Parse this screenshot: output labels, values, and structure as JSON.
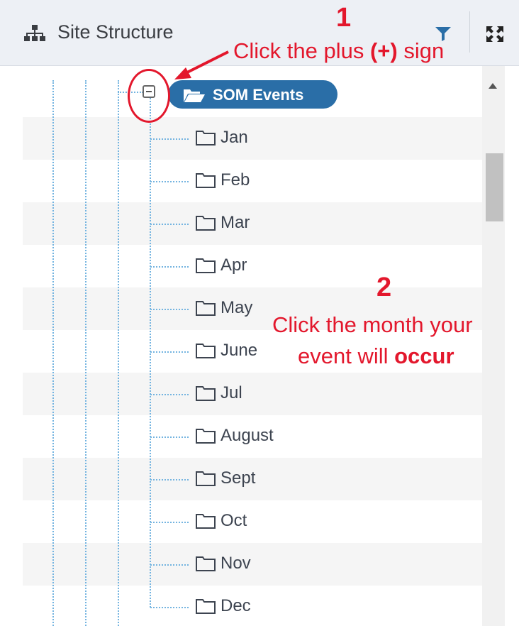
{
  "header": {
    "title": "Site Structure",
    "icons": {
      "sitemap": "sitemap-icon",
      "filter": "filter-icon",
      "expand": "expand-icon"
    }
  },
  "tree": {
    "root": {
      "label": "SOM Events",
      "icon": "folder-open-icon",
      "toggle": "minus-box-icon"
    },
    "months": [
      "Jan",
      "Feb",
      "Mar",
      "Apr",
      "May",
      "June",
      "Jul",
      "August",
      "Sept",
      "Oct",
      "Nov",
      "Dec"
    ]
  },
  "annotations": {
    "step1": {
      "number": "1",
      "text_before": "Click the plus ",
      "text_bold": "(+)",
      "text_after": " sign"
    },
    "step2": {
      "number": "2",
      "line1": "Click the month your",
      "line2_before": "event will ",
      "line2_bold": "occur"
    }
  },
  "colors": {
    "accent": "#2a6ea7",
    "annotation": "#e3172c",
    "tree_line": "#74b4e0",
    "header_bg": "#edf0f5"
  }
}
